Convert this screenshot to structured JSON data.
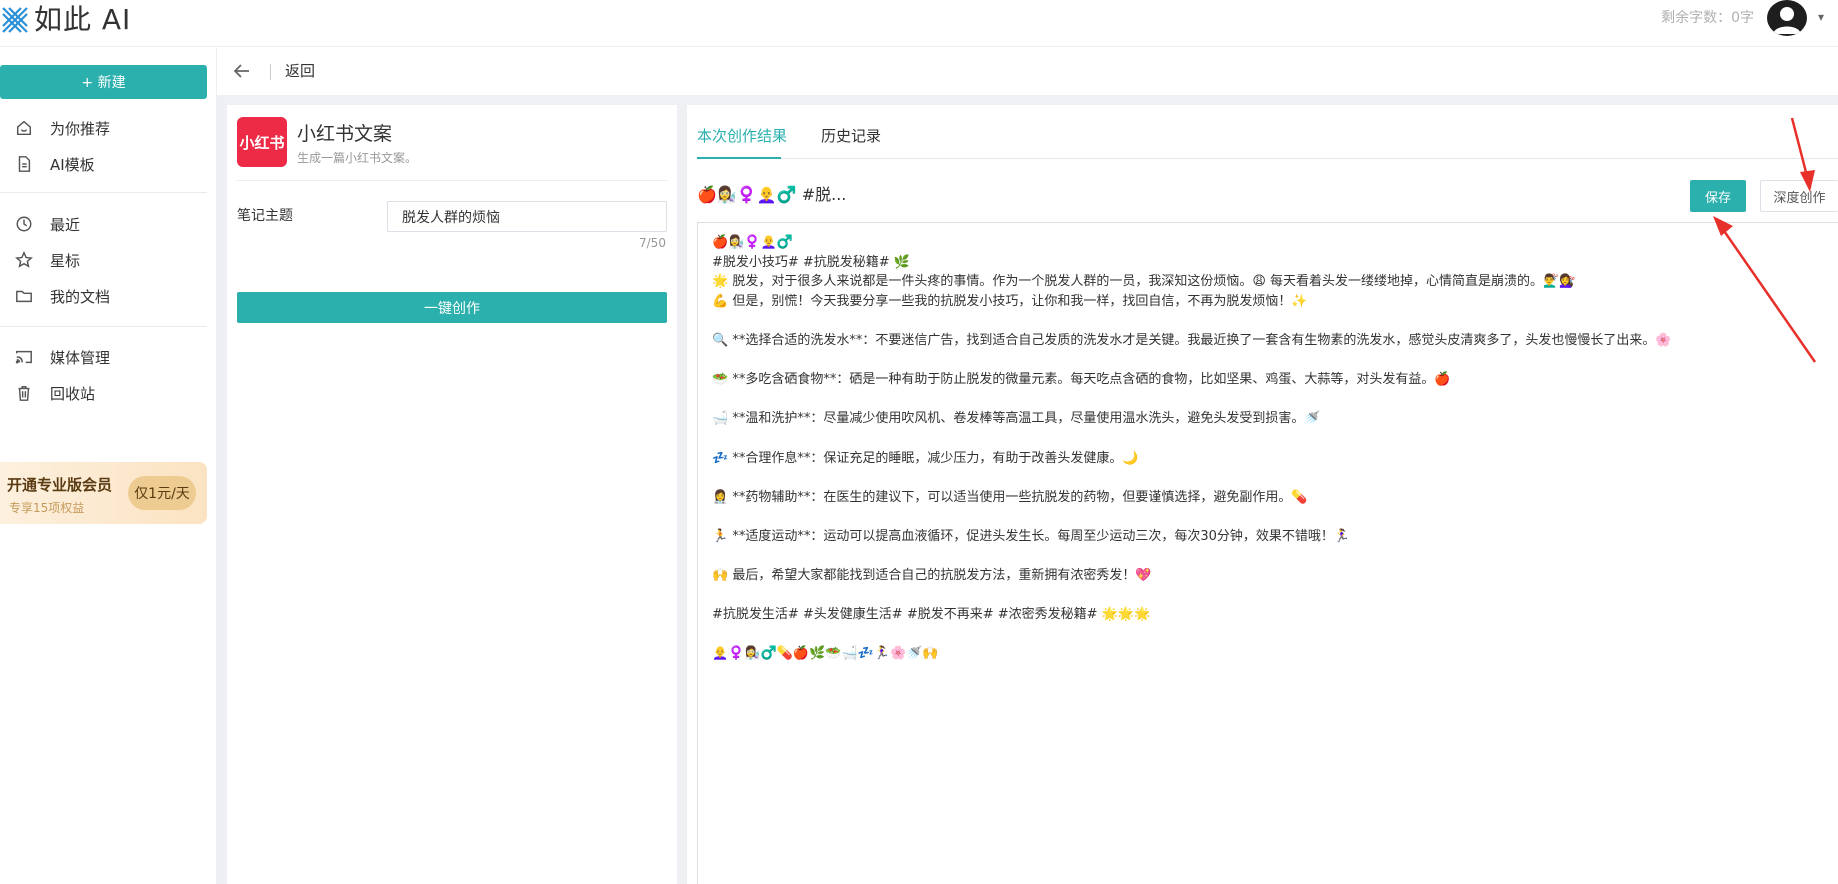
{
  "topbar": {
    "brand": "如此 AI",
    "quota_text": "剩余字数：0字",
    "caret": "▾"
  },
  "sidebar": {
    "new_label": "+ 新建",
    "items": [
      {
        "label": "为你推荐",
        "icon": "home-icon"
      },
      {
        "label": "AI模板",
        "icon": "document-icon"
      },
      {
        "label": "最近",
        "icon": "clock-icon"
      },
      {
        "label": "星标",
        "icon": "star-icon"
      },
      {
        "label": "我的文档",
        "icon": "folder-icon"
      },
      {
        "label": "媒体管理",
        "icon": "cast-icon"
      },
      {
        "label": "回收站",
        "icon": "trash-icon"
      }
    ],
    "promo": {
      "title": "开通专业版会员",
      "subtitle": "专享15项权益",
      "price": "仅1元/天"
    }
  },
  "backbar": {
    "label": "返回"
  },
  "left_panel": {
    "app_logo_text": "小红书",
    "app_title": "小红书文案",
    "app_desc": "生成一篇小红书文案。",
    "field_label": "笔记主题",
    "field_value": "脱发人群的烦恼",
    "field_count": "7/50",
    "create_label": "一键创作"
  },
  "right_panel": {
    "tabs": [
      {
        "label": "本次创作结果",
        "active": true
      },
      {
        "label": "历史记录",
        "active": false
      }
    ],
    "result_title": "🍎👩‍🔬♀️👩‍🦲♂️ #脱...",
    "save_label": "保存",
    "deep_label": "深度创作",
    "content_lines": [
      "🍎👩‍🔬♀️👩‍🦲♂️",
      "#脱发小技巧# #抗脱发秘籍# 🌿",
      "🌟 脱发，对于很多人来说都是一件头疼的事情。作为一个脱发人群的一员，我深知这份烦恼。😩 每天看着头发一缕缕地掉，心情简直是崩溃的。💇‍♂️💇‍♀️",
      "💪 但是，别慌！今天我要分享一些我的抗脱发小技巧，让你和我一样，找回自信，不再为脱发烦恼！✨",
      "",
      "🔍 **选择合适的洗发水**：不要迷信广告，找到适合自己发质的洗发水才是关键。我最近换了一套含有生物素的洗发水，感觉头皮清爽多了，头发也慢慢长了出来。🌸",
      "",
      "🥗 **多吃含硒食物**：硒是一种有助于防止脱发的微量元素。每天吃点含硒的食物，比如坚果、鸡蛋、大蒜等，对头发有益。🍎",
      "",
      "🛁 **温和洗护**：尽量减少使用吹风机、卷发棒等高温工具，尽量使用温水洗头，避免头发受到损害。🚿",
      "",
      "💤 **合理作息**：保证充足的睡眠，减少压力，有助于改善头发健康。🌙",
      "",
      "👩‍⚕️ **药物辅助**：在医生的建议下，可以适当使用一些抗脱发的药物，但要谨慎选择，避免副作用。💊",
      "",
      "🏃 **适度运动**：运动可以提高血液循环，促进头发生长。每周至少运动三次，每次30分钟，效果不错哦！🏃‍♀️",
      "",
      "🙌 最后，希望大家都能找到适合自己的抗脱发方法，重新拥有浓密秀发！💖",
      "",
      "#抗脱发生活# #头发健康生活# #脱发不再来# #浓密秀发秘籍# 🌟🌟🌟",
      "",
      "👩‍🦲♀️👩‍🔬♂️💊🍎🌿🥗🛁💤🏃‍♀️🌸🚿🙌"
    ]
  },
  "colors": {
    "accent": "#2bb0ae",
    "xhs_red": "#ee2b47",
    "arrow_red": "#e8302a"
  }
}
